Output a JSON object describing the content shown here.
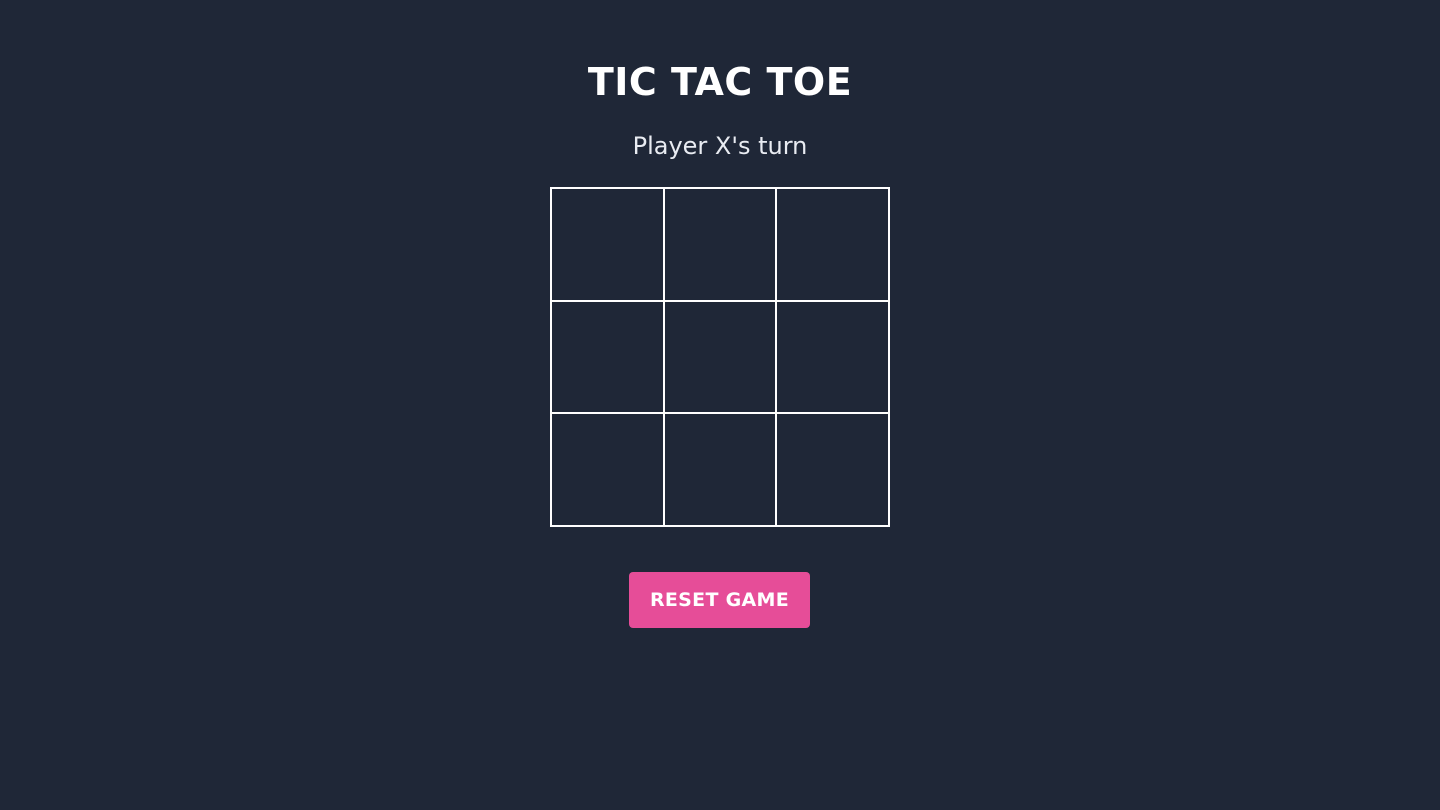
{
  "game": {
    "title": "TIC TAC TOE",
    "status": "Player X's turn",
    "board": [
      "",
      "",
      "",
      "",
      "",
      "",
      "",
      "",
      ""
    ],
    "reset_label": "RESET GAME"
  },
  "colors": {
    "background": "#1f2737",
    "grid_lines": "#ffffff",
    "reset_button": "#e64d98"
  }
}
